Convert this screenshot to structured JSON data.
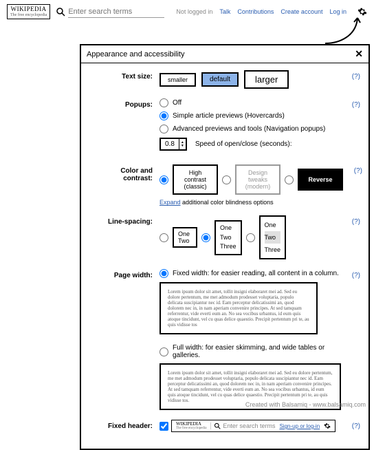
{
  "top": {
    "brand": "WIKIPEDIA",
    "tagline": "The free encyclopedia",
    "search_placeholder": "Enter search terms",
    "not_logged": "Not logged in",
    "links": [
      "Talk",
      "Contributions",
      "Create account",
      "Log in"
    ]
  },
  "panel": {
    "title": "Appearance and accessibility",
    "help": "(?)"
  },
  "textsize": {
    "label": "Text size:",
    "options": [
      "smaller",
      "default",
      "larger"
    ]
  },
  "popups": {
    "label": "Popups:",
    "off": "Off",
    "simple": "Simple article previews (Hovercards)",
    "advanced": "Advanced previews and tools (Navigation popups)",
    "speed_val": "0.8",
    "speed_label": "Speed of open/close (seconds):"
  },
  "contrast": {
    "label": "Color and contrast:",
    "hc1": "High contrast",
    "hc2": "(classic)",
    "dt1": "Design tweaks",
    "dt2": "(modern)",
    "rev": "Reverse",
    "expand": "Expand",
    "expand_note": " additional color blindness options"
  },
  "linespacing": {
    "label": "Line-spacing:",
    "w1": "One",
    "w2": "Two",
    "w3": "Three"
  },
  "pagewidth": {
    "label": "Page width:",
    "fixed": "Fixed width: for easier reading, all content in a column.",
    "full": "Full width: for easier skimming, and wide tables or galleries.",
    "lorem_narrow": "Lorem ipsum dolor sit amet, tollit insigni elaboraret mei ad. Sed eu dolore pertentum, me met admodum prodesset voluptaria, populo delicata suscipiantur nec id. Eam perceptur delicatissimi an, quod dolorem nec in, in nam aperiam convenire principes. At sed tamquam referrentur, vide everti eum an. No sea vocibus urbantus, id eum quis atoque tincidunt, vel cu quas delice quaestio. Precipit pertentum pri te, au quis vidisse tos",
    "lorem_wide": "Lorem ipsum dolor sit amet, tollit insigni elaboraret mei ad. Sed eu dolore pertentum, me met admodum prodesset voluptaria, populo delicata suscipiantur nec id. Eam perceptur delicatissimi an, quod dolorem nec in, in nam aperiam convenire principes. At sed tamquam referrentur, vide everti eum an. No sea vocibus urbantus, id eum quis atoque tincidunt, vel cu quas delice quaestio. Precipit pertentum pri te, au quis vidisse tos."
  },
  "fixedheader": {
    "label": "Fixed header:",
    "brand": "WIKIPEDIA",
    "tagline": "The free encyclopedia",
    "search": "Enter search terms",
    "link": "Sign-up or log-in"
  },
  "watermark": {
    "prefix": "Created with Balsamiq - ",
    "link": "www.balsamiq.com"
  }
}
